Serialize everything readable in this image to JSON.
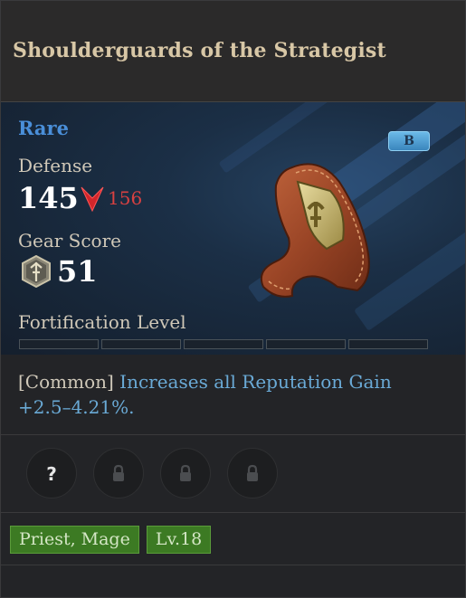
{
  "header": {
    "title": "Shoulderguards of the Strategist"
  },
  "item": {
    "rarity": "Rare",
    "rarity_color": "#4a8fd9",
    "grade_badge": "B",
    "defense_label": "Defense",
    "defense_value": "145",
    "defense_compare": "156",
    "defense_compare_icon": "down-arrow-icon",
    "gear_score_label": "Gear Score",
    "gear_score_icon": "gear-score-emblem-icon",
    "gear_score_value": "51",
    "fortification_label": "Fortification Level",
    "fortification_segments_filled": 0,
    "fortification_segments_total": 5
  },
  "effect": {
    "prefix": "[Common]",
    "text": "Increases all Reputation Gain",
    "value": "+2.5–4.21%."
  },
  "sockets": [
    {
      "state": "unknown",
      "icon": "question-mark-icon"
    },
    {
      "state": "locked",
      "icon": "lock-icon"
    },
    {
      "state": "locked",
      "icon": "lock-icon"
    },
    {
      "state": "locked",
      "icon": "lock-icon"
    }
  ],
  "requirements": {
    "classes": "Priest, Mage",
    "level": "Lv.18"
  }
}
